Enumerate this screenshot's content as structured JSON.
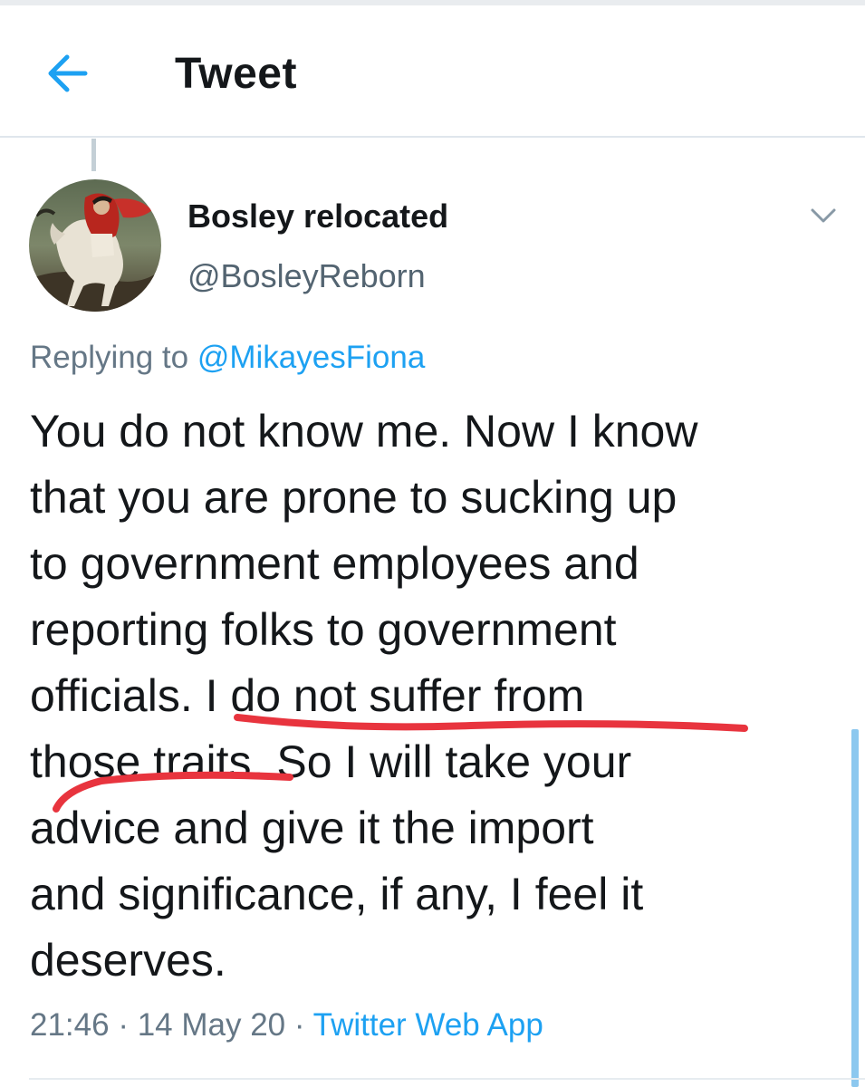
{
  "header": {
    "title": "Tweet",
    "back_icon": "arrow-left-icon"
  },
  "tweet": {
    "author": {
      "display_name": "Bosley relocated",
      "handle": "@BosleyReborn"
    },
    "replying_prefix": "Replying to",
    "replying_to": "@MikayesFiona",
    "body_lines": [
      "You do not know me.  Now I know",
      "that you are prone to sucking up",
      "to government employees and",
      "reporting folks to government",
      "officials.  I do not suffer from",
      "those traits.  So I will take your",
      "advice and give it the import",
      "and significance, if any, I feel it",
      "deserves."
    ],
    "time": "21:46",
    "separator": "·",
    "date": "14 May 20",
    "source": "Twitter Web App",
    "menu_icon": "chevron-down-icon"
  },
  "colors": {
    "accent": "#1da1f2",
    "muted": "#657786",
    "annotation": "#e8343e"
  }
}
